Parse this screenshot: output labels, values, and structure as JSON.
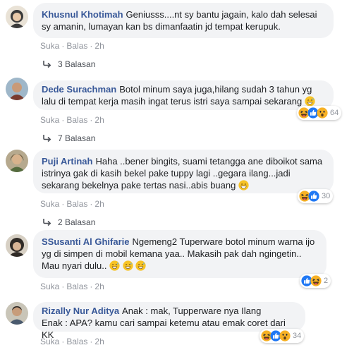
{
  "labels": {
    "like": "Suka",
    "reply": "Balas",
    "separator": "·"
  },
  "comments": [
    {
      "author": "Khusnul Khotimah",
      "text": "Geniusss....nt sy bantu jagain, kalo dah selesai sy amanin, lumayan kan bs dimanfaatin jd tempat kerupuk.",
      "time": "2h",
      "replies": "3 Balasan"
    },
    {
      "author": "Dede Surachman",
      "text": "Botol minum saya juga,hilang sudah 3 tahun yg lalu di tempat kerja masih ingat terus istri saya sampai sekarang",
      "time": "2h",
      "reactions": {
        "count": "64",
        "icons": [
          "haha-icon",
          "like-icon",
          "wow-icon"
        ]
      },
      "replies": "7 Balasan"
    },
    {
      "author": "Puji Artinah",
      "text": "Haha ..bener bingits, suami tetangga ane diboikot sama istrinya gak di kasih bekel pake tuppy lagi ..gegara ilang...jadi sekarang bekelnya pake tertas nasi..abis buang",
      "time": "2h",
      "reactions": {
        "count": "30",
        "icons": [
          "haha-icon",
          "like-icon"
        ]
      },
      "replies": "2 Balasan"
    },
    {
      "author": "SSusanti Al Ghifarie",
      "text": "Ngemeng2 Tuperware botol minum warna ijo yg di simpen di mobil kemana yaa.. Makasih pak dah ngingetin.. Mau nyari dulu..",
      "time": "2h",
      "reactions": {
        "count": "2",
        "icons": [
          "like-icon",
          "haha-icon"
        ]
      }
    },
    {
      "author": "Rizally Nur Aditya",
      "text_line1": "Anak : mak, Tupperware nya Ilang",
      "text_line2": "Enak : APA? kamu cari sampai ketemu atau emak coret dari KK",
      "time": "2h",
      "reactions": {
        "count": "34",
        "icons": [
          "haha-icon",
          "like-icon",
          "wow-icon"
        ]
      }
    }
  ],
  "colors": {
    "author": "#385898",
    "bubble": "#f2f3f5",
    "meta": "#90949c",
    "like": "#2078f4",
    "haha": "#f7b125"
  }
}
